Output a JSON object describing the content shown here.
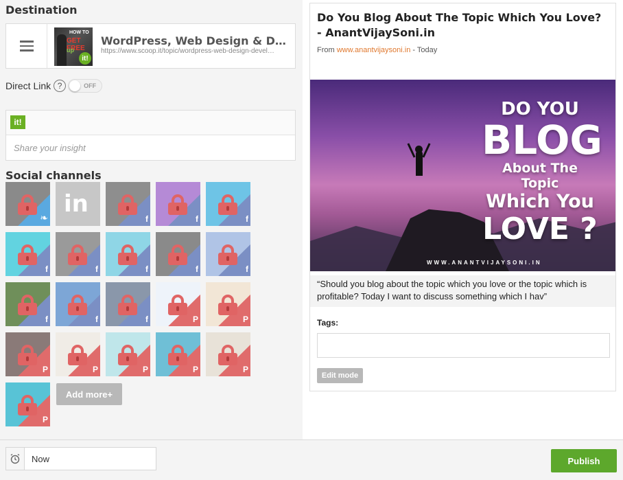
{
  "destination": {
    "heading": "Destination",
    "topic_title": "WordPress, Web Design & Develop…",
    "topic_url": "https://www.scoop.it/topic/wordpress-web-design-devel…",
    "thumb_lines": [
      "HOW TO",
      "GET FREE",
      "up"
    ],
    "thumb_badge": "it!"
  },
  "direct_link": {
    "label": "Direct Link",
    "help": "?",
    "toggle_state": "OFF"
  },
  "insight": {
    "brand_icon": "it!",
    "placeholder": "Share your insight"
  },
  "social": {
    "heading": "Social channels",
    "channels": [
      {
        "network": "twitter",
        "locked": true,
        "tile": "#5aa9e0",
        "bg": "#8a8a8a"
      },
      {
        "network": "linkedin",
        "locked": false,
        "tile": "#c7c7c7",
        "bg": "#c7c7c7"
      },
      {
        "network": "facebook",
        "locked": true,
        "tile": "#7b8fc4",
        "bg": "#8e8e8e"
      },
      {
        "network": "facebook",
        "locked": true,
        "tile": "#7b8fc4",
        "bg": "#b58ad6"
      },
      {
        "network": "facebook",
        "locked": true,
        "tile": "#7b8fc4",
        "bg": "#6ec4e6"
      },
      {
        "network": "facebook",
        "locked": true,
        "tile": "#7b8fc4",
        "bg": "#62d3e0"
      },
      {
        "network": "facebook",
        "locked": true,
        "tile": "#7b8fc4",
        "bg": "#9a9a9a"
      },
      {
        "network": "facebook",
        "locked": true,
        "tile": "#7b8fc4",
        "bg": "#8fd6e6"
      },
      {
        "network": "facebook",
        "locked": true,
        "tile": "#7b8fc4",
        "bg": "#8a8a8a"
      },
      {
        "network": "facebook",
        "locked": true,
        "tile": "#7b8fc4",
        "bg": "#b0c4e6"
      },
      {
        "network": "facebook",
        "locked": true,
        "tile": "#7b8fc4",
        "bg": "#6f8f5a"
      },
      {
        "network": "facebook",
        "locked": true,
        "tile": "#7b8fc4",
        "bg": "#7da6d6"
      },
      {
        "network": "facebook",
        "locked": true,
        "tile": "#7b8fc4",
        "bg": "#8a97aa"
      },
      {
        "network": "pinterest",
        "locked": true,
        "tile": "#e06b6b",
        "bg": "#eef3fa"
      },
      {
        "network": "pinterest",
        "locked": true,
        "tile": "#e06b6b",
        "bg": "#f2e6d6"
      },
      {
        "network": "pinterest",
        "locked": true,
        "tile": "#e06b6b",
        "bg": "#8a7a78"
      },
      {
        "network": "pinterest",
        "locked": true,
        "tile": "#e06b6b",
        "bg": "#f0ece6"
      },
      {
        "network": "pinterest",
        "locked": true,
        "tile": "#e06b6b",
        "bg": "#bfe6ea"
      },
      {
        "network": "pinterest",
        "locked": true,
        "tile": "#e06b6b",
        "bg": "#6fbfd6"
      },
      {
        "network": "pinterest",
        "locked": true,
        "tile": "#e06b6b",
        "bg": "#e8e2d8"
      },
      {
        "network": "pinterest",
        "locked": true,
        "tile": "#e06b6b",
        "bg": "#58c3d6"
      }
    ],
    "add_more_label": "Add more+"
  },
  "article": {
    "title": "Do You Blog About The Topic Which You Love? - AnantVijaySoni.in",
    "from_prefix": "From ",
    "source": "www.anantvijaysoni.in",
    "when": " - Today",
    "image_text": [
      "DO YOU",
      "BLOG",
      "About The Topic",
      "Which You",
      "LOVE ?"
    ],
    "image_caption": "WWW.ANANTVIJAYSONI.IN",
    "excerpt": "“Should you blog about the topic which you love or the topic which is profitable? Today I want to discuss something which I hav”",
    "tags_label": "Tags:",
    "edit_mode_label": "Edit mode"
  },
  "footer": {
    "time_value": "Now",
    "publish_label": "Publish"
  },
  "colors": {
    "accent_green": "#5da82c",
    "source_link": "#e0782e",
    "lock_red": "#e06464"
  }
}
